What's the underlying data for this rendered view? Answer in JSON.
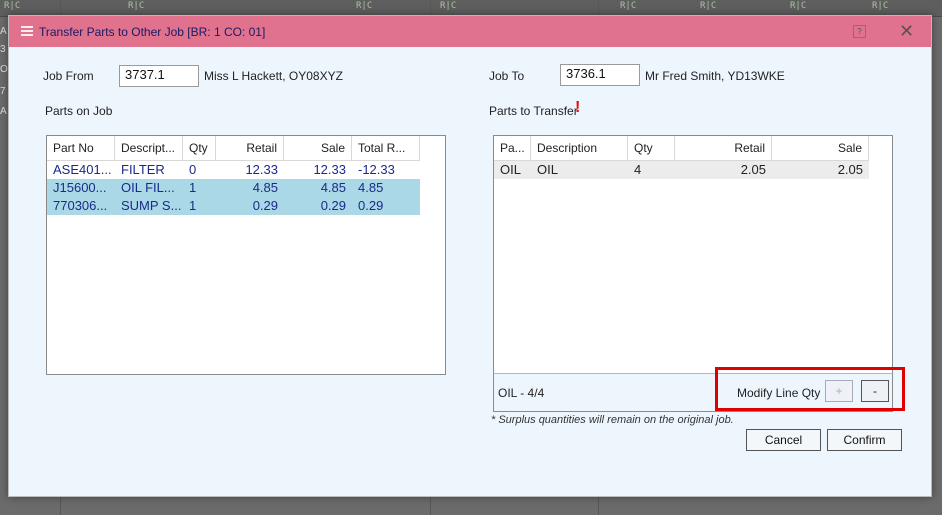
{
  "background": {
    "glyph": "R|C",
    "left_letters": [
      "A",
      "3",
      "O",
      "7",
      "A"
    ]
  },
  "dialog": {
    "title": "Transfer Parts to Other Job [BR: 1 CO: 01]",
    "help_glyph": "?",
    "close_glyph": "✕"
  },
  "job_from": {
    "label": "Job From",
    "value": "3737.1",
    "customer": "Miss L Hackett, OY08XYZ"
  },
  "job_to": {
    "label": "Job To",
    "value": "3736.1",
    "customer": "Mr Fred Smith, YD13WKE"
  },
  "parts_on_job": {
    "label": "Parts on Job",
    "columns": [
      "Part No",
      "Descript...",
      "Qty",
      "Retail",
      "Sale",
      "Total R..."
    ],
    "rows": [
      [
        "ASE401...",
        "FILTER",
        "0",
        "12.33",
        "12.33",
        "-12.33"
      ],
      [
        "J15600...",
        "OIL FIL...",
        "1",
        "4.85",
        "4.85",
        "4.85"
      ],
      [
        "770306...",
        "SUMP S...",
        "1",
        "0.29",
        "0.29",
        "0.29"
      ]
    ]
  },
  "parts_to_transfer": {
    "label": "Parts to Transfer",
    "required_mark": "!",
    "columns": [
      "Pa...",
      "Description",
      "Qty",
      "Retail",
      "Sale"
    ],
    "rows": [
      [
        "OIL",
        "OIL",
        "4",
        "2.05",
        "2.05"
      ]
    ],
    "status": "OIL - 4/4",
    "modify_label": "Modify Line Qty",
    "plus_label": "+",
    "minus_label": "-"
  },
  "note": "* Surplus quantities will remain on the original job.",
  "buttons": {
    "cancel": "Cancel",
    "confirm": "Confirm"
  }
}
